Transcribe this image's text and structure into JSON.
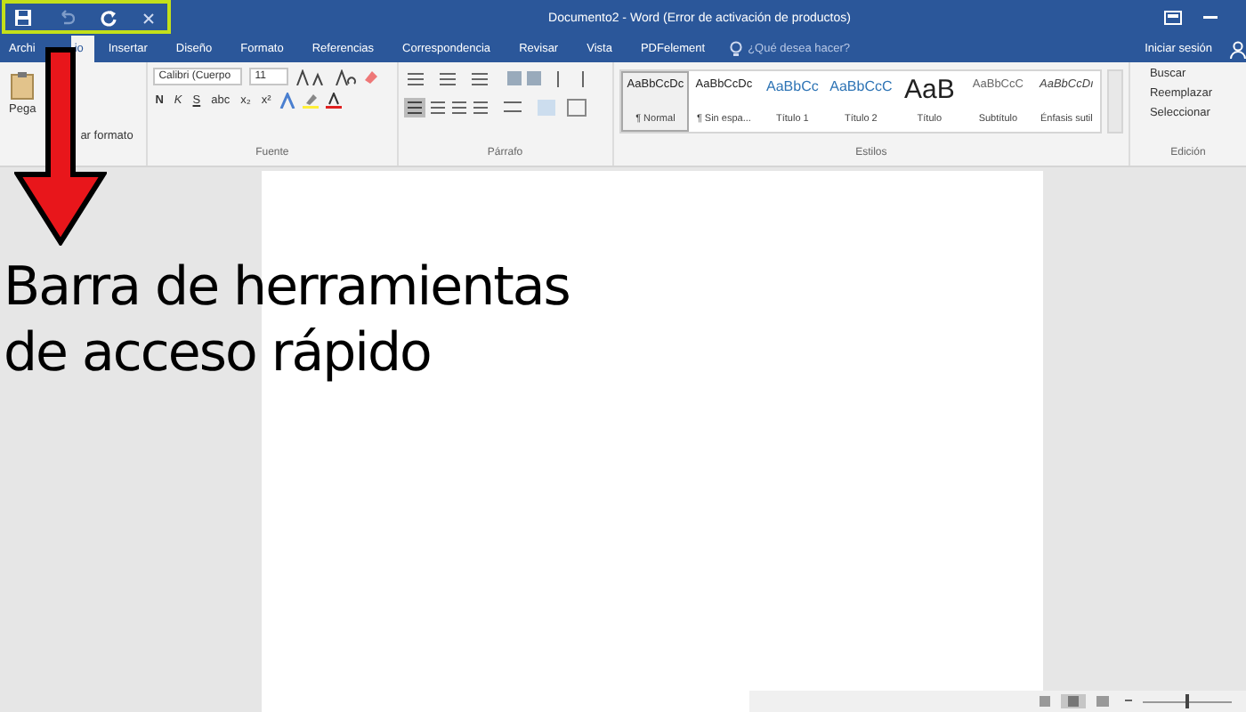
{
  "window": {
    "title": "Documento2 - Word (Error de activación de productos)",
    "sign_in": "Iniciar sesión"
  },
  "tabs": [
    {
      "label": "Archi",
      "selected": false
    },
    {
      "label": "io",
      "selected": true
    },
    {
      "label": "Insertar",
      "selected": false
    },
    {
      "label": "Diseño",
      "selected": false
    },
    {
      "label": "Formato",
      "selected": false
    },
    {
      "label": "Referencias",
      "selected": false
    },
    {
      "label": "Correspondencia",
      "selected": false
    },
    {
      "label": "Revisar",
      "selected": false
    },
    {
      "label": "Vista",
      "selected": false
    },
    {
      "label": "PDFelement",
      "selected": false
    }
  ],
  "tell_me": {
    "placeholder": "¿Qué desea hacer?"
  },
  "clipboard": {
    "paste": "Pega",
    "format_painter": "ar formato"
  },
  "font": {
    "name": "Calibri (Cuerpo",
    "size": "11",
    "buttons": [
      "N",
      "K",
      "S",
      "abc",
      "x₂",
      "x²"
    ],
    "label": "Fuente"
  },
  "paragraph": {
    "label": "Párrafo"
  },
  "styles": {
    "items": [
      {
        "sample": "AaBbCcDc",
        "name": "¶ Normal",
        "selected": true,
        "kind": "normal"
      },
      {
        "sample": "AaBbCcDc",
        "name": "¶ Sin espa...",
        "selected": false,
        "kind": "normal"
      },
      {
        "sample": "AaBbCc",
        "name": "Título 1",
        "selected": false,
        "kind": "heading"
      },
      {
        "sample": "AaBbCcC",
        "name": "Título 2",
        "selected": false,
        "kind": "heading"
      },
      {
        "sample": "AaB",
        "name": "Título",
        "selected": false,
        "kind": "title"
      },
      {
        "sample": "AaBbCcC",
        "name": "Subtítulo",
        "selected": false,
        "kind": "subtle"
      },
      {
        "sample": "AaBbCcDı",
        "name": "Énfasis sutil",
        "selected": false,
        "kind": "emphasis"
      }
    ],
    "label": "Estilos"
  },
  "editing": {
    "items": [
      "Buscar",
      "Reemplazar",
      "Seleccionar"
    ],
    "label": "Edición"
  },
  "zoom": {
    "level": 0.5
  },
  "annotation": {
    "lines": [
      "Barra de herramientas",
      "de acceso rápido"
    ]
  }
}
